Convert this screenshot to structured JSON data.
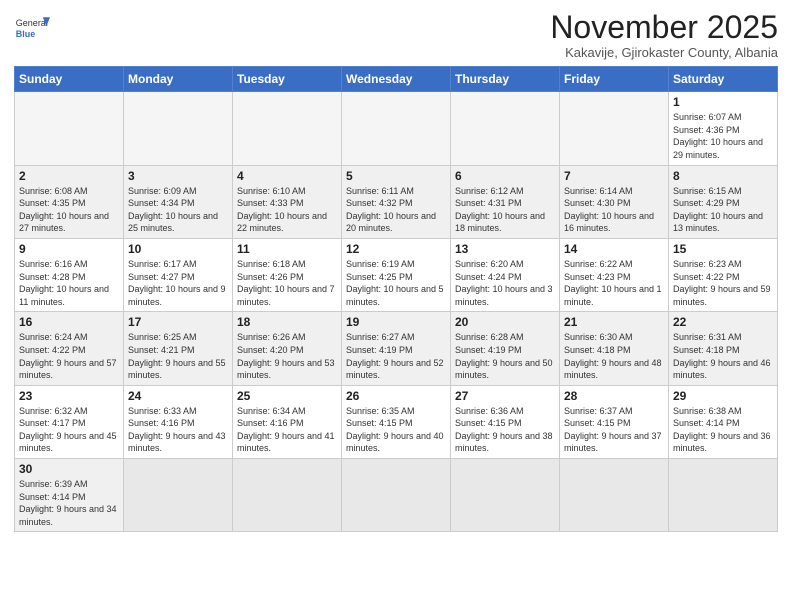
{
  "logo": {
    "text_general": "General",
    "text_blue": "Blue"
  },
  "header": {
    "month_year": "November 2025",
    "location": "Kakavije, Gjirokaster County, Albania"
  },
  "days_of_week": [
    "Sunday",
    "Monday",
    "Tuesday",
    "Wednesday",
    "Thursday",
    "Friday",
    "Saturday"
  ],
  "weeks": [
    [
      {
        "num": "",
        "info": ""
      },
      {
        "num": "",
        "info": ""
      },
      {
        "num": "",
        "info": ""
      },
      {
        "num": "",
        "info": ""
      },
      {
        "num": "",
        "info": ""
      },
      {
        "num": "",
        "info": ""
      },
      {
        "num": "1",
        "info": "Sunrise: 6:07 AM\nSunset: 4:36 PM\nDaylight: 10 hours\nand 29 minutes."
      }
    ],
    [
      {
        "num": "2",
        "info": "Sunrise: 6:08 AM\nSunset: 4:35 PM\nDaylight: 10 hours\nand 27 minutes."
      },
      {
        "num": "3",
        "info": "Sunrise: 6:09 AM\nSunset: 4:34 PM\nDaylight: 10 hours\nand 25 minutes."
      },
      {
        "num": "4",
        "info": "Sunrise: 6:10 AM\nSunset: 4:33 PM\nDaylight: 10 hours\nand 22 minutes."
      },
      {
        "num": "5",
        "info": "Sunrise: 6:11 AM\nSunset: 4:32 PM\nDaylight: 10 hours\nand 20 minutes."
      },
      {
        "num": "6",
        "info": "Sunrise: 6:12 AM\nSunset: 4:31 PM\nDaylight: 10 hours\nand 18 minutes."
      },
      {
        "num": "7",
        "info": "Sunrise: 6:14 AM\nSunset: 4:30 PM\nDaylight: 10 hours\nand 16 minutes."
      },
      {
        "num": "8",
        "info": "Sunrise: 6:15 AM\nSunset: 4:29 PM\nDaylight: 10 hours\nand 13 minutes."
      }
    ],
    [
      {
        "num": "9",
        "info": "Sunrise: 6:16 AM\nSunset: 4:28 PM\nDaylight: 10 hours\nand 11 minutes."
      },
      {
        "num": "10",
        "info": "Sunrise: 6:17 AM\nSunset: 4:27 PM\nDaylight: 10 hours\nand 9 minutes."
      },
      {
        "num": "11",
        "info": "Sunrise: 6:18 AM\nSunset: 4:26 PM\nDaylight: 10 hours\nand 7 minutes."
      },
      {
        "num": "12",
        "info": "Sunrise: 6:19 AM\nSunset: 4:25 PM\nDaylight: 10 hours\nand 5 minutes."
      },
      {
        "num": "13",
        "info": "Sunrise: 6:20 AM\nSunset: 4:24 PM\nDaylight: 10 hours\nand 3 minutes."
      },
      {
        "num": "14",
        "info": "Sunrise: 6:22 AM\nSunset: 4:23 PM\nDaylight: 10 hours\nand 1 minute."
      },
      {
        "num": "15",
        "info": "Sunrise: 6:23 AM\nSunset: 4:22 PM\nDaylight: 9 hours\nand 59 minutes."
      }
    ],
    [
      {
        "num": "16",
        "info": "Sunrise: 6:24 AM\nSunset: 4:22 PM\nDaylight: 9 hours\nand 57 minutes."
      },
      {
        "num": "17",
        "info": "Sunrise: 6:25 AM\nSunset: 4:21 PM\nDaylight: 9 hours\nand 55 minutes."
      },
      {
        "num": "18",
        "info": "Sunrise: 6:26 AM\nSunset: 4:20 PM\nDaylight: 9 hours\nand 53 minutes."
      },
      {
        "num": "19",
        "info": "Sunrise: 6:27 AM\nSunset: 4:19 PM\nDaylight: 9 hours\nand 52 minutes."
      },
      {
        "num": "20",
        "info": "Sunrise: 6:28 AM\nSunset: 4:19 PM\nDaylight: 9 hours\nand 50 minutes."
      },
      {
        "num": "21",
        "info": "Sunrise: 6:30 AM\nSunset: 4:18 PM\nDaylight: 9 hours\nand 48 minutes."
      },
      {
        "num": "22",
        "info": "Sunrise: 6:31 AM\nSunset: 4:18 PM\nDaylight: 9 hours\nand 46 minutes."
      }
    ],
    [
      {
        "num": "23",
        "info": "Sunrise: 6:32 AM\nSunset: 4:17 PM\nDaylight: 9 hours\nand 45 minutes."
      },
      {
        "num": "24",
        "info": "Sunrise: 6:33 AM\nSunset: 4:16 PM\nDaylight: 9 hours\nand 43 minutes."
      },
      {
        "num": "25",
        "info": "Sunrise: 6:34 AM\nSunset: 4:16 PM\nDaylight: 9 hours\nand 41 minutes."
      },
      {
        "num": "26",
        "info": "Sunrise: 6:35 AM\nSunset: 4:15 PM\nDaylight: 9 hours\nand 40 minutes."
      },
      {
        "num": "27",
        "info": "Sunrise: 6:36 AM\nSunset: 4:15 PM\nDaylight: 9 hours\nand 38 minutes."
      },
      {
        "num": "28",
        "info": "Sunrise: 6:37 AM\nSunset: 4:15 PM\nDaylight: 9 hours\nand 37 minutes."
      },
      {
        "num": "29",
        "info": "Sunrise: 6:38 AM\nSunset: 4:14 PM\nDaylight: 9 hours\nand 36 minutes."
      }
    ],
    [
      {
        "num": "30",
        "info": "Sunrise: 6:39 AM\nSunset: 4:14 PM\nDaylight: 9 hours\nand 34 minutes."
      },
      {
        "num": "",
        "info": ""
      },
      {
        "num": "",
        "info": ""
      },
      {
        "num": "",
        "info": ""
      },
      {
        "num": "",
        "info": ""
      },
      {
        "num": "",
        "info": ""
      },
      {
        "num": "",
        "info": ""
      }
    ]
  ]
}
